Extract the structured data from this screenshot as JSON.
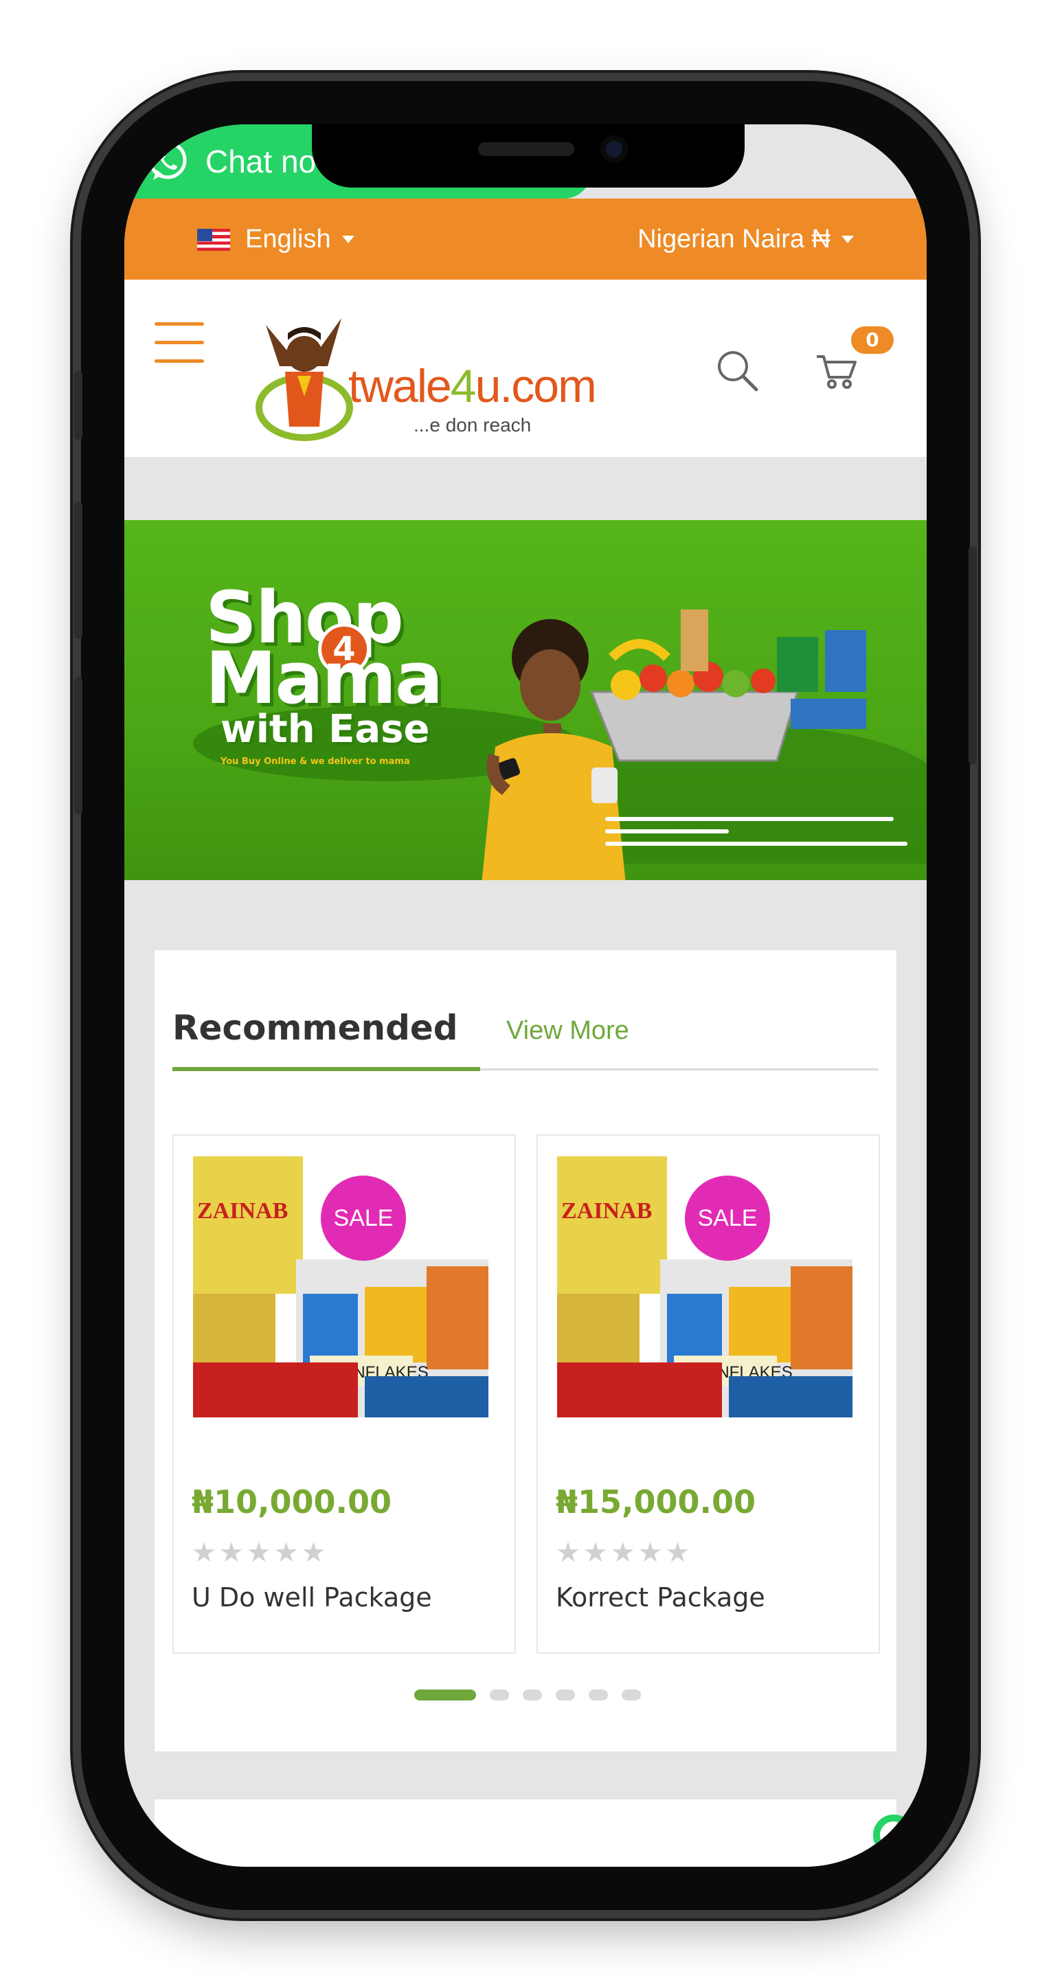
{
  "chat": {
    "label": "Chat no"
  },
  "topbar": {
    "language": "English",
    "currency": "Nigerian Naira ₦"
  },
  "header": {
    "logo_text_a": "twale",
    "logo_text_b": "4",
    "logo_text_c": "u.com",
    "tagline": "...e don reach",
    "cart_count": "0"
  },
  "banner": {
    "line1": "Shop",
    "num": "4",
    "line2": "Mama",
    "line3": "with Ease",
    "sub": "You Buy Online & we deliver to mama"
  },
  "recommended": {
    "title": "Recommended",
    "view_more": "View More",
    "products": [
      {
        "sale": "SALE",
        "price": "₦10,000.00",
        "stars": "★★★★★",
        "name": "U Do well Package",
        "rating": 0
      },
      {
        "sale": "SALE",
        "price": "₦15,000.00",
        "stars": "★★★★★",
        "name": "Korrect Package",
        "rating": 0
      }
    ],
    "carousel_pages": 6,
    "carousel_active": 1
  },
  "colors": {
    "accent_orange": "#ee8b26",
    "whatsapp_green": "#25d366",
    "brand_green": "#6fa73a",
    "sale_pink": "#e22bb4"
  }
}
